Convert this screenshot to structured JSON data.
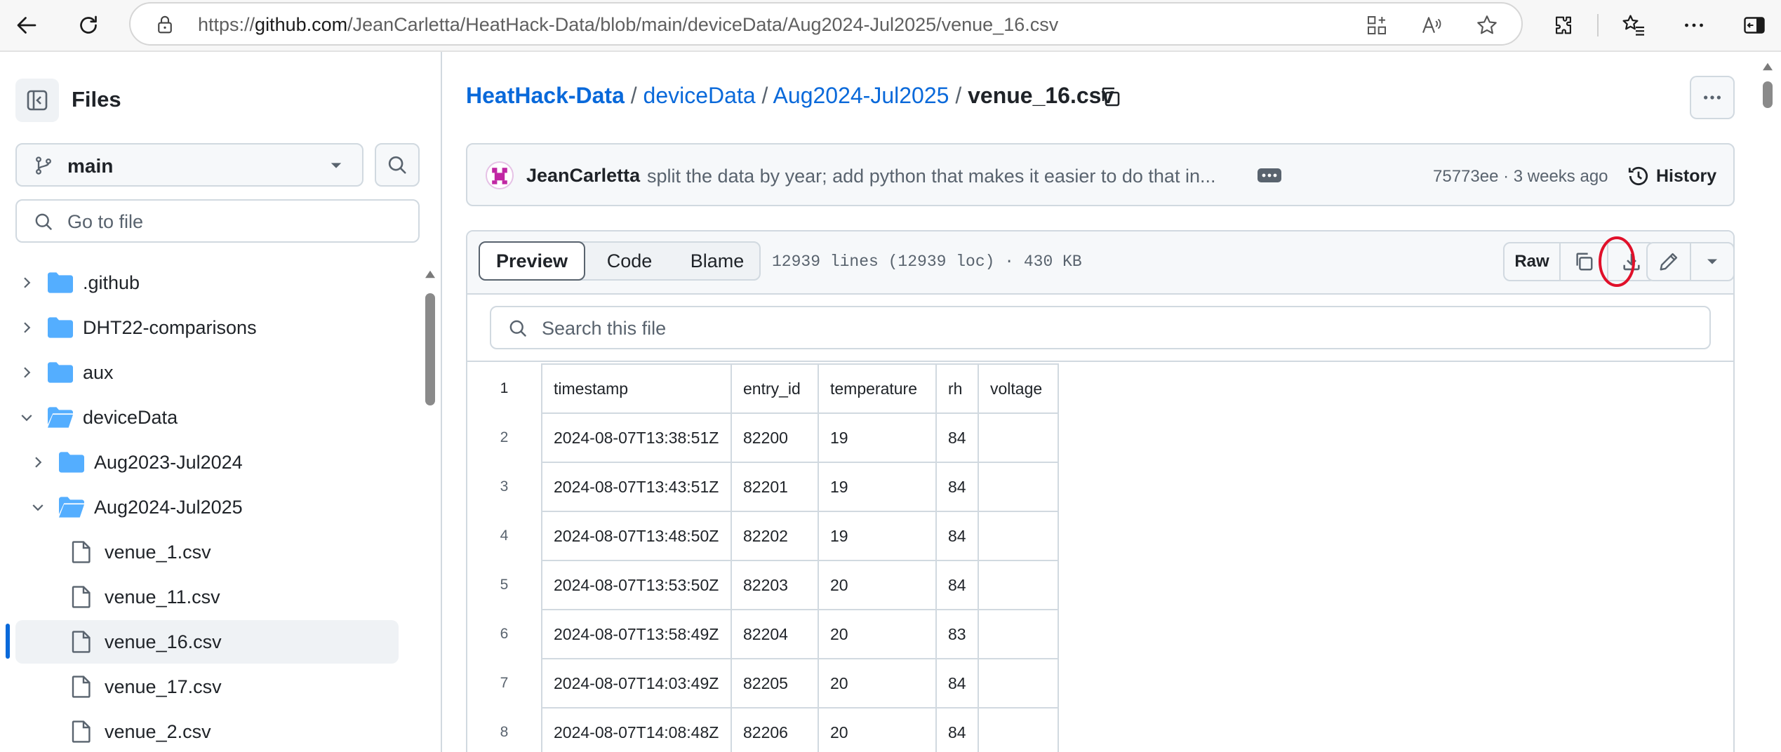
{
  "browser": {
    "url_prefix": "https://",
    "url_host": "github.com",
    "url_path": "/JeanCarletta/HeatHack-Data/blob/main/deviceData/Aug2024-Jul2025/venue_16.csv"
  },
  "sidebar": {
    "title": "Files",
    "branch": "main",
    "search_placeholder": "Go to file",
    "tree": [
      {
        "label": ".github",
        "type": "folder",
        "expanded": false
      },
      {
        "label": "DHT22-comparisons",
        "type": "folder",
        "expanded": false
      },
      {
        "label": "aux",
        "type": "folder",
        "expanded": false
      },
      {
        "label": "deviceData",
        "type": "folder",
        "expanded": true
      },
      {
        "label": "Aug2023-Jul2024",
        "type": "folder",
        "expanded": false
      },
      {
        "label": "Aug2024-Jul2025",
        "type": "folder",
        "expanded": true
      },
      {
        "label": "venue_1.csv",
        "type": "file"
      },
      {
        "label": "venue_11.csv",
        "type": "file"
      },
      {
        "label": "venue_16.csv",
        "type": "file",
        "selected": true
      },
      {
        "label": "venue_17.csv",
        "type": "file"
      },
      {
        "label": "venue_2.csv",
        "type": "file"
      }
    ]
  },
  "breadcrumb": {
    "repo": "HeatHack-Data",
    "sep": "/",
    "dir1": "deviceData",
    "dir2": "Aug2024-Jul2025",
    "file": "venue_16.csv"
  },
  "commit": {
    "author": "JeanCarletta",
    "message": "split the data by year; add python that makes it easier to do that in...",
    "meta": "75773ee · 3 weeks ago",
    "history_label": "History"
  },
  "file_toolbar": {
    "tabs": [
      "Preview",
      "Code",
      "Blame"
    ],
    "active_tab": "Preview",
    "stats": "12939 lines (12939 loc) · 430 KB",
    "raw_label": "Raw",
    "search_placeholder": "Search this file"
  },
  "csv": {
    "header_line": "1",
    "columns": [
      "timestamp",
      "entry_id",
      "temperature",
      "rh",
      "voltage"
    ],
    "rows": [
      {
        "line": "2",
        "cells": [
          "2024-08-07T13:38:51Z",
          "82200",
          "19",
          "84",
          ""
        ]
      },
      {
        "line": "3",
        "cells": [
          "2024-08-07T13:43:51Z",
          "82201",
          "19",
          "84",
          ""
        ]
      },
      {
        "line": "4",
        "cells": [
          "2024-08-07T13:48:50Z",
          "82202",
          "19",
          "84",
          ""
        ]
      },
      {
        "line": "5",
        "cells": [
          "2024-08-07T13:53:50Z",
          "82203",
          "20",
          "84",
          ""
        ]
      },
      {
        "line": "6",
        "cells": [
          "2024-08-07T13:58:49Z",
          "82204",
          "20",
          "83",
          ""
        ]
      },
      {
        "line": "7",
        "cells": [
          "2024-08-07T14:03:49Z",
          "82205",
          "20",
          "84",
          ""
        ]
      },
      {
        "line": "8",
        "cells": [
          "2024-08-07T14:08:48Z",
          "82206",
          "20",
          "84",
          ""
        ]
      }
    ]
  },
  "colors": {
    "link": "#0969da",
    "border": "#d1d9e0",
    "selected_indicator": "#0969da",
    "highlight_circle": "#e0102a"
  }
}
